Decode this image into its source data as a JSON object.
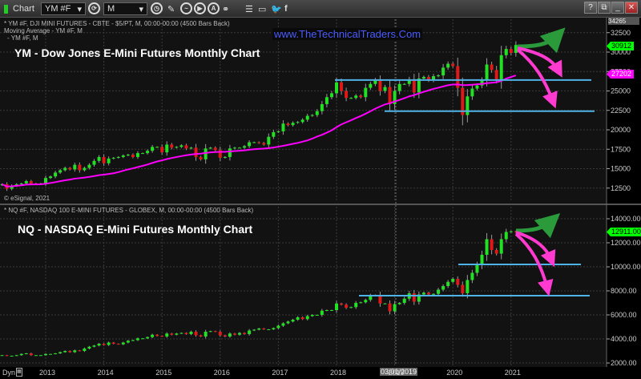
{
  "toolbar": {
    "app_label": "Chart",
    "symbol": "YM #F",
    "interval": "M",
    "window_buttons": [
      "?",
      "⧉",
      "_",
      "□",
      "✕"
    ]
  },
  "top_pane": {
    "header_line1": "* YM #F, DJI MINI FUTURES - CBTE - $5/PT, M, 00:00-00:00 (4500 Bars Back)",
    "header_line2": "Moving Average - YM #F, M",
    "header_line3": "- YM #F, M",
    "title": "YM - Dow Jones E-Mini Futures Monthly Chart",
    "watermark_url": "www.TheTechnicalTraders.Com",
    "copyright": "© eSignal, 2021",
    "axis_top_label": "34265",
    "price_tag": "30912",
    "ma_tag": "27202"
  },
  "bottom_pane": {
    "header_line1": "* NQ #F, NASDAQ 100 E-MINI FUTURES - GLOBEX, M, 00:00-00:00 (4500 Bars Back)",
    "title": "NQ - NASDAQ E-Mini Futures Monthly Chart",
    "price_tag": "12911.00"
  },
  "x_axis": {
    "dyn_label": "Dyn",
    "cursor_label": "03/01/2019",
    "ticks": [
      "2013",
      "2014",
      "2015",
      "2016",
      "2017",
      "2018",
      "2019",
      "2020",
      "2021"
    ]
  },
  "colors": {
    "up": "#22e022",
    "down": "#e01818",
    "ma": "#ff00ff",
    "support": "#4fb3e8",
    "arrow_up": "#2a9a3a",
    "arrow_down": "#ff3ad0",
    "price_tag": "#00ff00"
  },
  "chart_data": [
    {
      "type": "candlestick",
      "title": "YM - Dow Jones E-Mini Futures Monthly Chart",
      "start": "2012-04",
      "interval": "monthly",
      "yticks": [
        12500,
        15000,
        17500,
        20000,
        22500,
        25000,
        27500,
        30000,
        32500
      ],
      "ylim": [
        10000,
        34265
      ],
      "closes": [
        13000,
        12400,
        12800,
        13000,
        13100,
        13400,
        13100,
        13000,
        13100,
        13800,
        14000,
        14500,
        14800,
        15100,
        14900,
        15500,
        14800,
        15100,
        15500,
        16000,
        16500,
        15700,
        16300,
        16400,
        16500,
        16700,
        16800,
        16500,
        17000,
        17000,
        17300,
        17800,
        17800,
        17100,
        18100,
        17700,
        17800,
        18000,
        17600,
        17700,
        16500,
        16200,
        17600,
        17700,
        17400,
        16400,
        16500,
        17600,
        17700,
        17700,
        17900,
        18400,
        18400,
        18300,
        18100,
        19100,
        19700,
        19800,
        20800,
        20600,
        20900,
        21000,
        21300,
        21800,
        21900,
        22400,
        23300,
        24200,
        24700,
        26100,
        25000,
        24100,
        24100,
        24400,
        24200,
        25400,
        25900,
        26400,
        25000,
        25500,
        23300,
        25000,
        25900,
        25900,
        26500,
        24800,
        26600,
        26800,
        26400,
        26900,
        27000,
        28000,
        28500,
        28200,
        25400,
        21900,
        24300,
        25300,
        25700,
        26400,
        28400,
        27700,
        26500,
        29600,
        30400,
        29900,
        30912
      ],
      "moving_average_last": 27202,
      "support_levels": [
        26400,
        22400
      ]
    },
    {
      "type": "candlestick",
      "title": "NQ - NASDAQ E-Mini Futures Monthly Chart",
      "start": "2012-04",
      "interval": "monthly",
      "yticks": [
        2000,
        4000,
        6000,
        8000,
        10000,
        12000,
        14000
      ],
      "ylim": [
        1700,
        15000
      ],
      "closes": [
        2650,
        2600,
        2600,
        2650,
        2750,
        2800,
        2650,
        2650,
        2650,
        2750,
        2750,
        2800,
        2900,
        3000,
        2900,
        3050,
        3000,
        3200,
        3350,
        3450,
        3600,
        3500,
        3700,
        3600,
        3550,
        3700,
        3850,
        3900,
        4050,
        4050,
        4150,
        4350,
        4250,
        4200,
        4450,
        4350,
        4450,
        4500,
        4400,
        4600,
        4300,
        4200,
        4600,
        4650,
        4600,
        4300,
        4200,
        4450,
        4350,
        4500,
        4400,
        4700,
        4770,
        4870,
        4800,
        4800,
        4900,
        5100,
        5300,
        5450,
        5600,
        5800,
        5650,
        5900,
        6000,
        6000,
        6350,
        6400,
        6400,
        6950,
        6850,
        6600,
        6650,
        7000,
        7050,
        7250,
        7600,
        7650,
        6950,
        6950,
        6300,
        6900,
        7000,
        7350,
        7800,
        7100,
        7700,
        7850,
        7700,
        7750,
        8100,
        8400,
        8750,
        9000,
        8500,
        7800,
        8900,
        9500,
        10150,
        11000,
        12300,
        11400,
        11100,
        12300,
        12900,
        12950,
        12911
      ],
      "support_levels": [
        10200,
        7600
      ]
    }
  ]
}
